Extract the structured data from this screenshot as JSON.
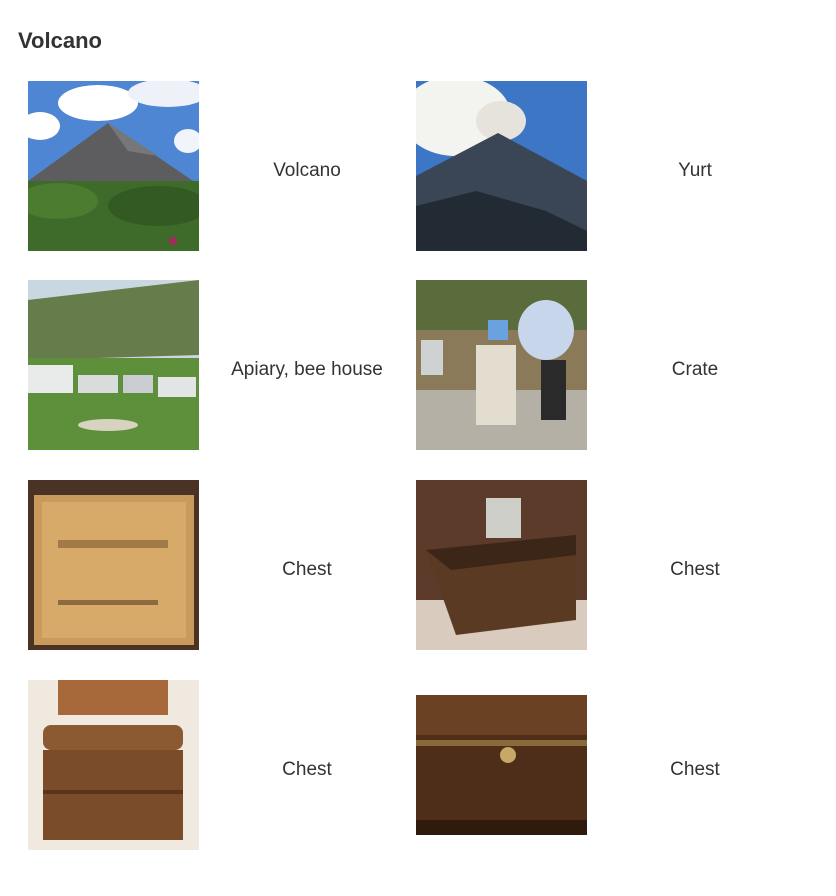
{
  "heading": "Volcano",
  "grid": [
    {
      "label": "Volcano",
      "image": "volcano-photo"
    },
    {
      "label": "Yurt",
      "image": "erupting-volcano-photo"
    },
    {
      "label": "Apiary, bee house",
      "image": "caravan-field-photo"
    },
    {
      "label": "Crate",
      "image": "beekeeper-hive-photo"
    },
    {
      "label": "Chest",
      "image": "wooden-crate-photo"
    },
    {
      "label": "Chest",
      "image": "open-chest-photo"
    },
    {
      "label": "Chest",
      "image": "wooden-chest-photo"
    },
    {
      "label": "Chest",
      "image": "old-chest-photo"
    }
  ]
}
